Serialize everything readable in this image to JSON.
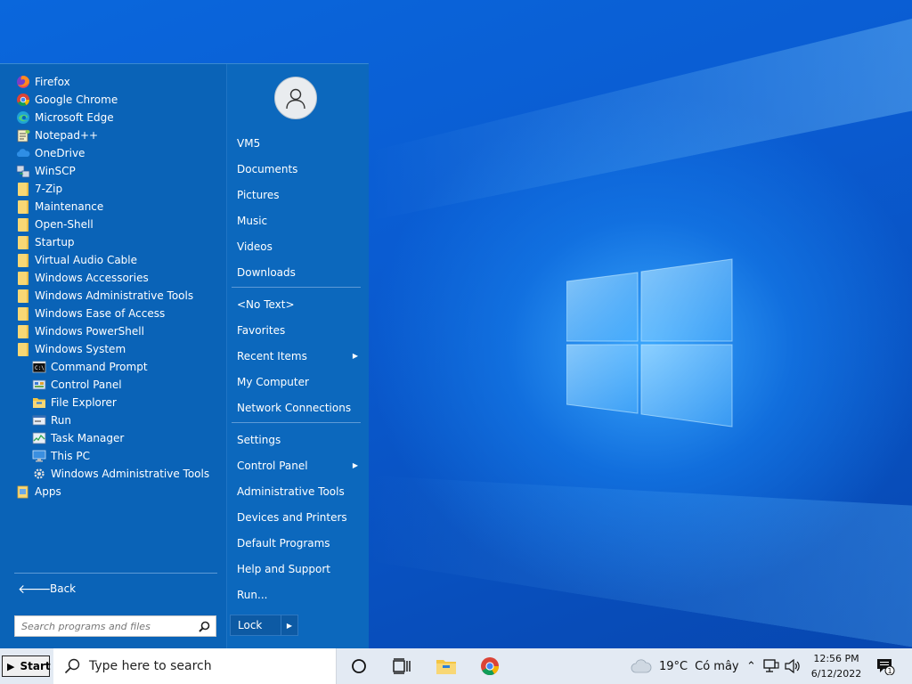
{
  "programs": [
    {
      "label": "Firefox",
      "icon": "firefox-icon",
      "sub": false
    },
    {
      "label": "Google Chrome",
      "icon": "chrome-icon",
      "sub": false
    },
    {
      "label": "Microsoft Edge",
      "icon": "edge-icon",
      "sub": false
    },
    {
      "label": "Notepad++",
      "icon": "notepadpp-icon",
      "sub": false
    },
    {
      "label": "OneDrive",
      "icon": "onedrive-icon",
      "sub": false
    },
    {
      "label": "WinSCP",
      "icon": "winscp-icon",
      "sub": false
    },
    {
      "label": "7-Zip",
      "icon": "folder-icon",
      "sub": false
    },
    {
      "label": "Maintenance",
      "icon": "folder-icon",
      "sub": false
    },
    {
      "label": "Open-Shell",
      "icon": "folder-icon",
      "sub": false
    },
    {
      "label": "Startup",
      "icon": "folder-icon",
      "sub": false
    },
    {
      "label": "Virtual Audio Cable",
      "icon": "folder-icon",
      "sub": false
    },
    {
      "label": "Windows Accessories",
      "icon": "folder-icon",
      "sub": false
    },
    {
      "label": "Windows Administrative Tools",
      "icon": "folder-icon",
      "sub": false
    },
    {
      "label": "Windows Ease of Access",
      "icon": "folder-icon",
      "sub": false
    },
    {
      "label": "Windows PowerShell",
      "icon": "folder-icon",
      "sub": false
    },
    {
      "label": "Windows System",
      "icon": "folder-icon",
      "sub": false
    },
    {
      "label": "Command Prompt",
      "icon": "cmd-icon",
      "sub": true
    },
    {
      "label": "Control Panel",
      "icon": "control-panel-icon",
      "sub": true
    },
    {
      "label": "File Explorer",
      "icon": "file-explorer-icon",
      "sub": true
    },
    {
      "label": "Run",
      "icon": "run-icon",
      "sub": true
    },
    {
      "label": "Task Manager",
      "icon": "task-manager-icon",
      "sub": true
    },
    {
      "label": "This PC",
      "icon": "this-pc-icon",
      "sub": true
    },
    {
      "label": "Windows Administrative Tools",
      "icon": "admin-tools-icon",
      "sub": true
    },
    {
      "label": "Apps",
      "icon": "apps-icon",
      "sub": false
    }
  ],
  "back_label": "Back",
  "search_placeholder": "Search programs and files",
  "right_groups": [
    [
      {
        "label": "VM5",
        "submenu": false
      },
      {
        "label": "Documents",
        "submenu": false
      },
      {
        "label": "Pictures",
        "submenu": false
      },
      {
        "label": "Music",
        "submenu": false
      },
      {
        "label": "Videos",
        "submenu": false
      },
      {
        "label": "Downloads",
        "submenu": false
      }
    ],
    [
      {
        "label": "<No Text>",
        "submenu": false
      },
      {
        "label": "Favorites",
        "submenu": false
      },
      {
        "label": "Recent Items",
        "submenu": true
      },
      {
        "label": "My Computer",
        "submenu": false
      },
      {
        "label": "Network Connections",
        "submenu": false
      }
    ],
    [
      {
        "label": "Settings",
        "submenu": false
      },
      {
        "label": "Control Panel",
        "submenu": true
      },
      {
        "label": "Administrative Tools",
        "submenu": false
      },
      {
        "label": "Devices and Printers",
        "submenu": false
      },
      {
        "label": "Default Programs",
        "submenu": false
      },
      {
        "label": "Help and Support",
        "submenu": false
      },
      {
        "label": "Run...",
        "submenu": false
      }
    ]
  ],
  "lock_label": "Lock",
  "taskbar": {
    "start_label": "Start",
    "search_placeholder": "Type here to search",
    "weather_temp": "19°C",
    "weather_text": "Có mây",
    "time": "12:56 PM",
    "date": "6/12/2022",
    "notification_count": "1"
  },
  "colors": {
    "menu_bg": "#0a63b7",
    "taskbar_bg": "#e3eaf3",
    "desktop_blue": "#0a5cd2"
  }
}
